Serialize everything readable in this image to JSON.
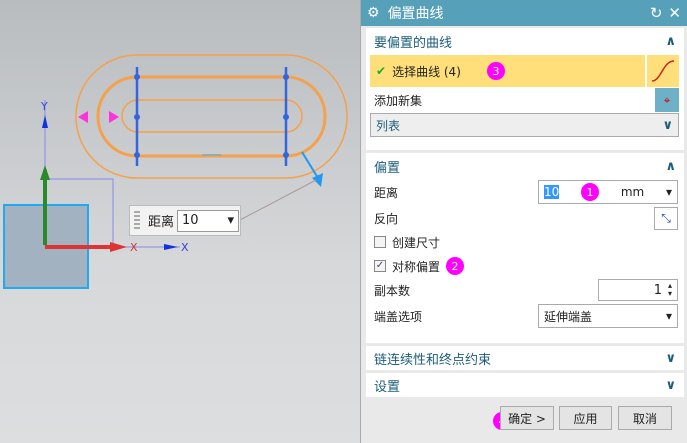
{
  "dialog": {
    "title": "偏置曲线"
  },
  "curves": {
    "header": "要偏置的曲线",
    "select_label": "选择曲线 (4)",
    "add_set": "添加新集",
    "list": "列表"
  },
  "offset": {
    "header": "偏置",
    "distance_label": "距离",
    "distance_value": "10",
    "unit": "mm",
    "reverse_label": "反向",
    "create_dim": "创建尺寸",
    "create_dim_checked": false,
    "symmetric": "对称偏置",
    "symmetric_checked": true,
    "copies_label": "副本数",
    "copies_value": "1",
    "cap_label": "端盖选项",
    "cap_value": "延伸端盖"
  },
  "chain": {
    "header": "链连续性和终点约束"
  },
  "settings": {
    "header": "设置"
  },
  "buttons": {
    "ok": "确定 >",
    "apply": "应用",
    "cancel": "取消"
  },
  "badges": [
    "1",
    "2",
    "3",
    "4"
  ],
  "canvas": {
    "dim_label": "距离",
    "dim_value": "10",
    "axis_x": "X",
    "axis_y": "Y"
  },
  "colors": {
    "title_bar": "#56a0b9",
    "highlight": "#fedf7a",
    "curve": "#f5a04a",
    "badge": "#ff00ff"
  }
}
